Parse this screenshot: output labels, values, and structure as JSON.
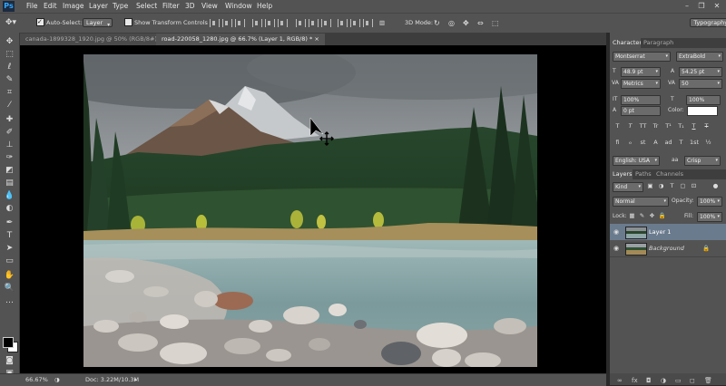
{
  "app": {
    "logo": "Ps"
  },
  "menu": [
    "File",
    "Edit",
    "Image",
    "Layer",
    "Type",
    "Select",
    "Filter",
    "3D",
    "View",
    "Window",
    "Help"
  ],
  "options": {
    "auto_select_label": "Auto-Select:",
    "auto_select_value": "Layer",
    "show_transform_label": "Show Transform Controls",
    "mode_3d_label": "3D Mode:",
    "workspace": "Typography"
  },
  "tabs": [
    {
      "label": "canada-1899328_1920.jpg @ 50% (RGB/8#)"
    },
    {
      "label": "road-220058_1280.jpg @ 66.7% (Layer 1, RGB/8) *"
    }
  ],
  "status": {
    "zoom": "66.67%",
    "doc": "Doc: 3.22M/10.3M"
  },
  "character": {
    "tab_character": "Character",
    "tab_paragraph": "Paragraph",
    "font_family": "Montserrat",
    "font_style": "ExtraBold",
    "font_size": "48.9 pt",
    "leading": "54.25 pt",
    "kerning": "Metrics",
    "tracking": "50",
    "vscale": "100%",
    "hscale": "100%",
    "baseline": "0 pt",
    "color_label": "Color:",
    "language": "English: USA",
    "antialias": "Crisp",
    "aa_label": "aa",
    "tt_buttons": [
      "T",
      "T",
      "TT",
      "Tr",
      "T¹",
      "T₁",
      "T",
      "T"
    ],
    "ot_buttons": [
      "ﬁ",
      "ℴ",
      "st",
      "A",
      "ad",
      "T",
      "1st",
      "½"
    ]
  },
  "layers": {
    "tab_layers": "Layers",
    "tab_paths": "Paths",
    "tab_channels": "Channels",
    "kind_label": "Kind",
    "blend_mode": "Normal",
    "opacity_label": "Opacity:",
    "opacity_value": "100%",
    "lock_label": "Lock:",
    "fill_label": "Fill:",
    "fill_value": "100%",
    "items": [
      {
        "name": "Layer 1",
        "selected": true
      },
      {
        "name": "Background",
        "selected": false
      }
    ]
  },
  "colors": {
    "accent": "#31a8ff",
    "selected_layer": "#6b7b8e"
  }
}
